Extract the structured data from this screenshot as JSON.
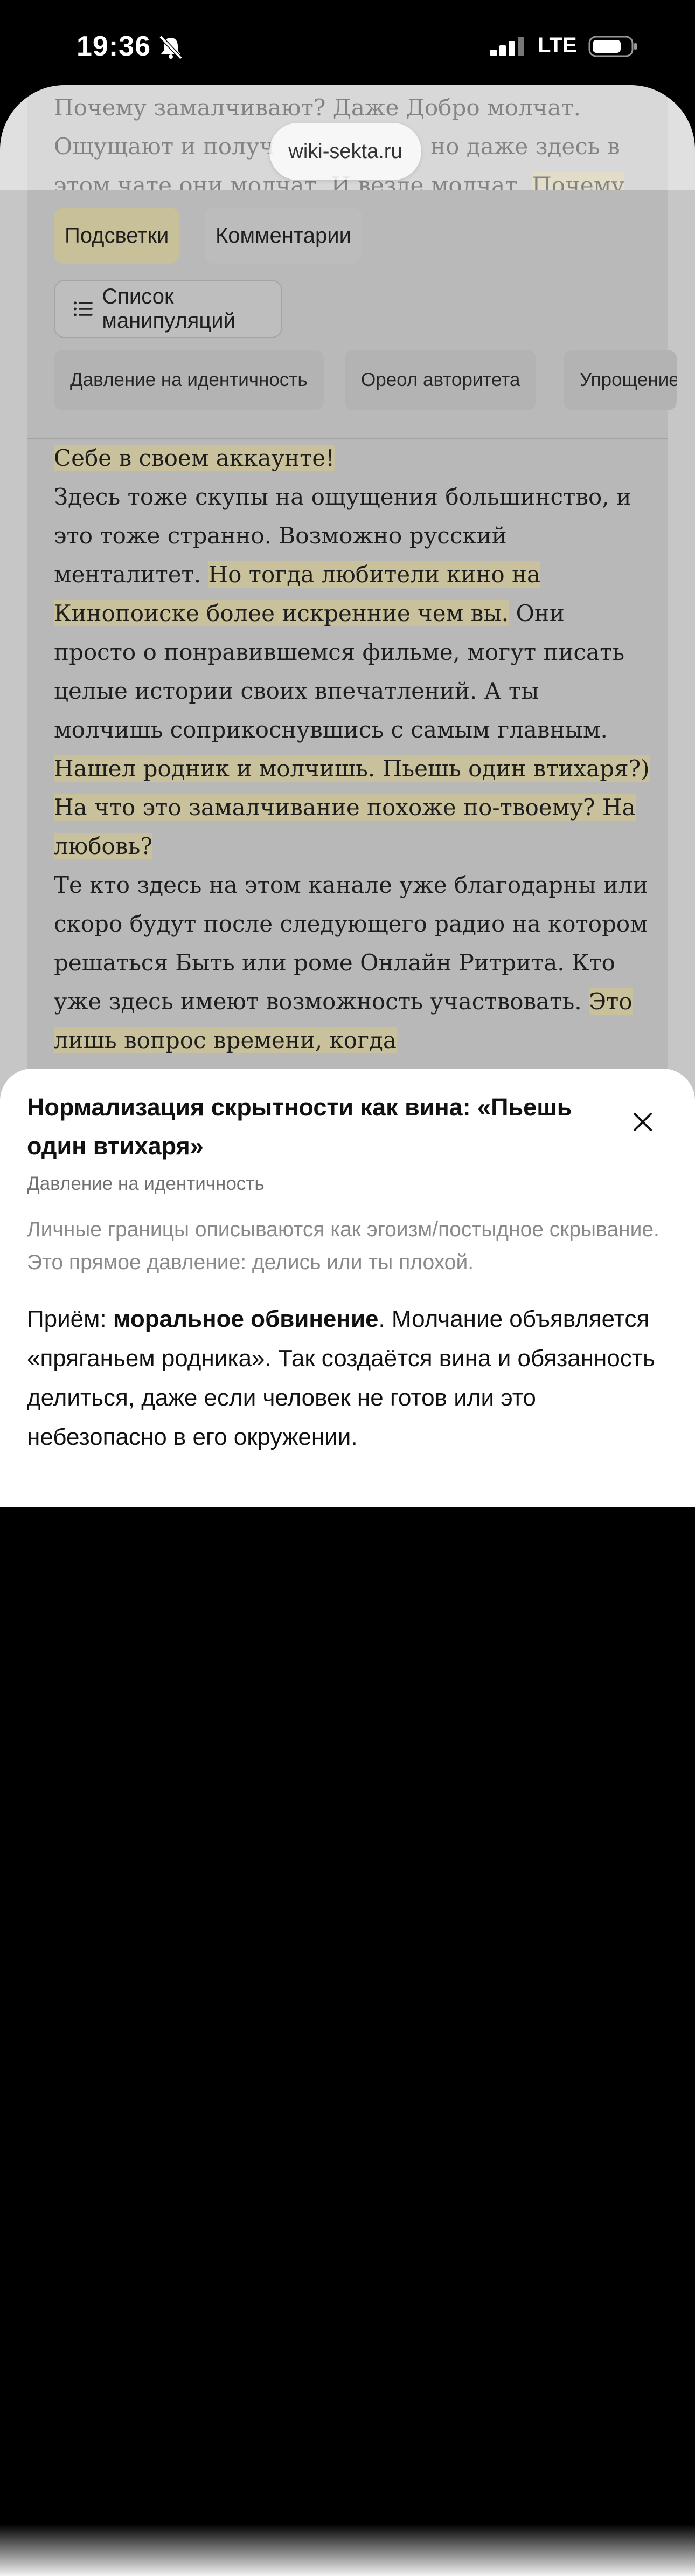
{
  "status_bar": {
    "time": "19:36",
    "network": "LTE"
  },
  "browser": {
    "url": "wiki-sekta.ru"
  },
  "article_top": {
    "line1": "Почему замалчивают? Даже Добро молчат.",
    "line2a": "Ощущают и получ",
    "line2b": "но даже здесь в",
    "line3a": "этом чате они молчат. И везде молчат.",
    "line3b": "Почему"
  },
  "tabs": {
    "highlights": "Подсветки",
    "comments": "Комментарии"
  },
  "manipulation_list_button": "Список манипуляций",
  "chips": [
    "Давление на идентичность",
    "Ореол авторитета",
    "Упрощение"
  ],
  "article": {
    "p0": "Себе в своем аккаунте!",
    "p1a": "Здесь тоже скупы на ощущения большинство, и это тоже странно. Возможно русский менталитет. ",
    "p1h": "Но тогда любители кино на Кинопоиске более искренние чем вы.",
    "p1b": " Они просто о понравившемся фильме, могут писать целые истории своих впечатлений. А ты молчишь соприкоснувшись с самым главным.",
    "p2h": " Нашел родник и молчишь. Пьешь один втихаря?)",
    "p3h": " На что это замалчивание похоже по-твоему? На любовь?",
    "p4a": "Те кто здесь на этом канале уже благодарны или скоро будут после следующего радио на котором решаться Быть или роме Онлайн Ритрита. Кто уже здесь имеют возможность участвовать. ",
    "p4h": "Это лишь вопрос времени, когда"
  },
  "detail": {
    "title": "Нормализация скрытности как вина: «Пьешь один втихаря»",
    "category": "Давление на идентичность",
    "description": "Личные границы описываются как эгоизм/постыдное скрывание. Это прямое давление: делись или ты плохой.",
    "body_prefix": "Приём: ",
    "body_bold": "моральное обвинение",
    "body_rest": ". Молчание объявляется «пряганьем родника». Так создаётся вина и обязанность делиться, даже если человек не готов или это небезопасно в его окружении."
  }
}
